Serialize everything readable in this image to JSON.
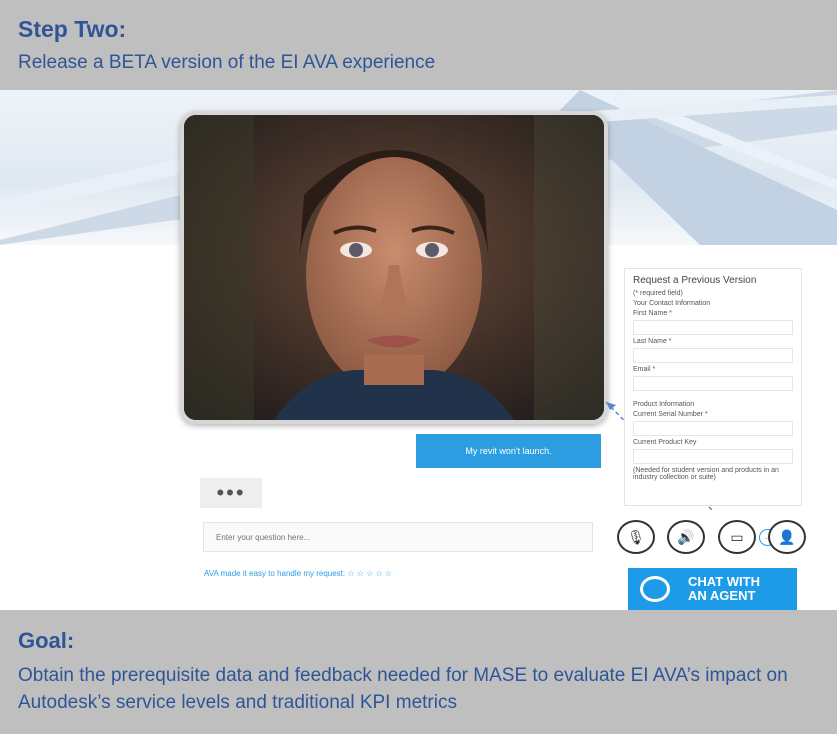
{
  "header": {
    "title": "Step Two:",
    "subtitle": "Release a BETA version of the EI AVA experience"
  },
  "screenshot": {
    "form": {
      "heading": "Request a Previous Version",
      "required_note": "(* required field)",
      "contact_section": "Your Contact Information",
      "first_name_label": "First Name *",
      "last_name_label": "Last Name *",
      "email_label": "Email *",
      "product_section": "Product Information",
      "serial_label": "Current Serial Number *",
      "product_key_label": "Current Product Key",
      "note": "(Needed for student version and products in an industry collection or suite)"
    },
    "chat": {
      "user_message": "My revit won't launch.",
      "typing_indicator": "•••",
      "input_placeholder": "Enter your question here...",
      "send_icon": "→",
      "rating_text": "AVA made it easy to handle my request: ☆ ☆ ☆ ☆ ☆"
    },
    "controls": {
      "mic_icon": "🎙",
      "speaker_icon": "🔊",
      "video_icon": "▭",
      "agent_icon": "👤"
    },
    "chat_agent_button": "CHAT WITH\nAN AGENT"
  },
  "footer": {
    "title": "Goal:",
    "text": "Obtain the prerequisite data and feedback needed for MASE to evaluate EI AVA’s impact on Autodesk’s service levels and traditional KPI metrics"
  }
}
